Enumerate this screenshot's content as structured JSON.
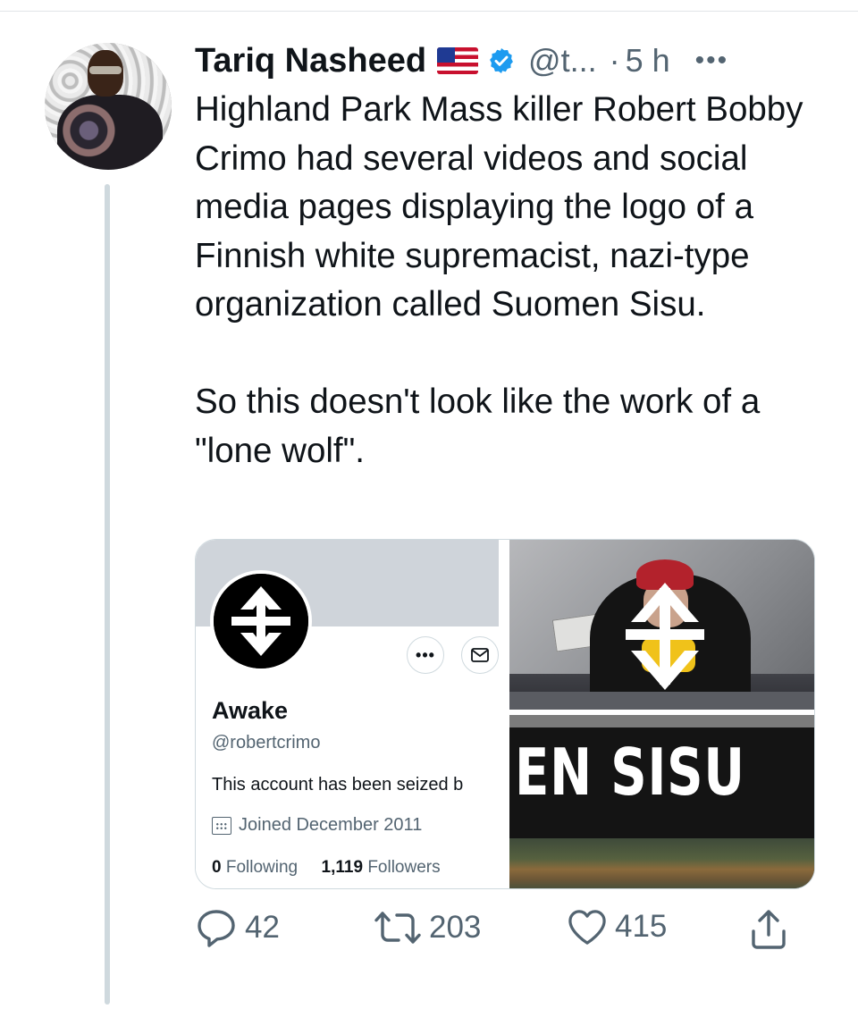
{
  "tweet": {
    "author_name": "Tariq Nasheed",
    "author_handle": "@t...",
    "separator": "·",
    "time": "5 h",
    "more_label": "•••",
    "icons": [
      "us-flag-icon",
      "verified-badge-icon",
      "more-icon"
    ],
    "text_paragraph_1": "Highland Park Mass killer Robert Bobby Crimo had several videos and social media pages displaying the logo of a Finnish white supremacist, nazi-type organization called Suomen Sisu.",
    "text_paragraph_2": "So this doesn't look like the work of a \"lone wolf\"."
  },
  "media": {
    "profile_card": {
      "name": "Awake",
      "handle": "@robertcrimo",
      "bio": "This account has been seized b",
      "joined": "Joined December 2011",
      "following_count": "0",
      "following_label": "Following",
      "followers_count": "1,119",
      "followers_label": "Followers",
      "more_pill": "•••"
    },
    "image_bottom_text": "EN SISU"
  },
  "actions": {
    "reply_count": "42",
    "retweet_count": "203",
    "like_count": "415"
  },
  "colors": {
    "text_primary": "#0f1419",
    "text_secondary": "#536471",
    "verified_blue": "#1d9bf0",
    "thread_line": "#cfd9de"
  }
}
